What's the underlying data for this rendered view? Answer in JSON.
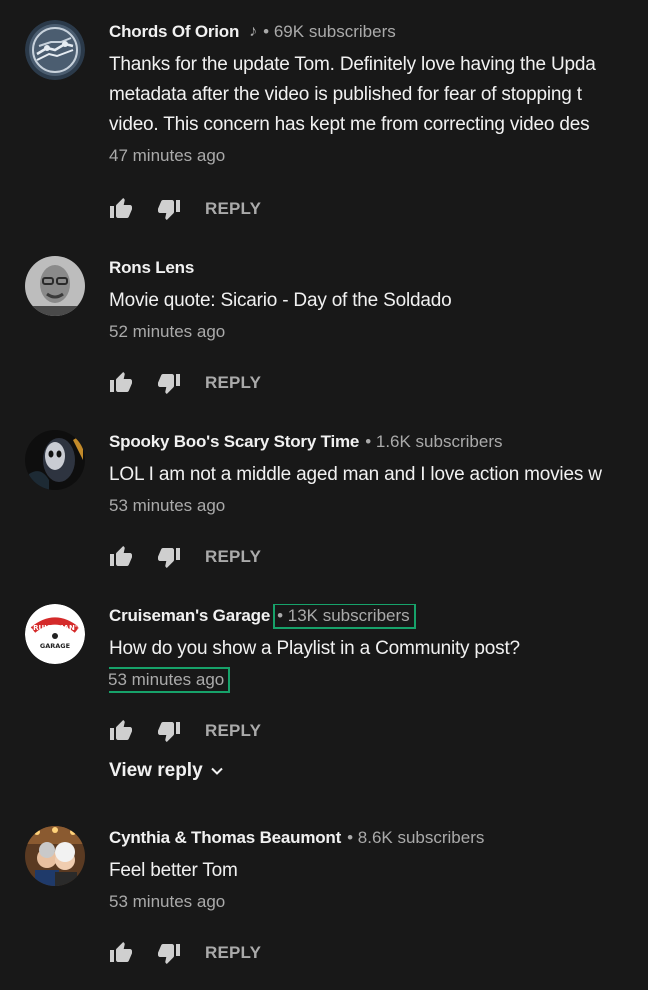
{
  "colors": {
    "background": "#181818",
    "primary_text": "#f1f1f1",
    "secondary_text": "#aaaaaa",
    "highlight_box": "#17a26a"
  },
  "comments": [
    {
      "author": "Chords Of Orion",
      "badge_icon": "music-note-icon",
      "subscribers": "• 69K subscribers",
      "lines": [
        "Thanks for the update Tom. Definitely love having the Upda",
        "metadata after the video is published for fear of stopping t",
        "video. This concern has kept me from correcting video des"
      ],
      "time": "47 minutes ago",
      "reply_label": "REPLY"
    },
    {
      "author": "Rons Lens",
      "lines": [
        "Movie quote: Sicario - Day of the Soldado"
      ],
      "time": "52 minutes ago",
      "reply_label": "REPLY"
    },
    {
      "author": "Spooky Boo's Scary Story Time",
      "subscribers": "• 1.6K subscribers",
      "lines": [
        "LOL I am not a middle aged man and I love action movies w"
      ],
      "time": "53 minutes ago",
      "reply_label": "REPLY"
    },
    {
      "author": "Cruiseman's Garage",
      "subscribers": "• 13K subscribers",
      "avatar_text_top": "CRUISEMAN'S",
      "avatar_text_bottom": "GARAGE",
      "lines": [
        "How do you show a Playlist in a Community post?"
      ],
      "time": "53 minutes ago",
      "reply_label": "REPLY",
      "view_reply_label": "View reply"
    },
    {
      "author": "Cynthia & Thomas Beaumont",
      "subscribers": "• 8.6K subscribers",
      "lines": [
        "Feel better Tom"
      ],
      "time": "53 minutes ago",
      "reply_label": "REPLY"
    }
  ]
}
